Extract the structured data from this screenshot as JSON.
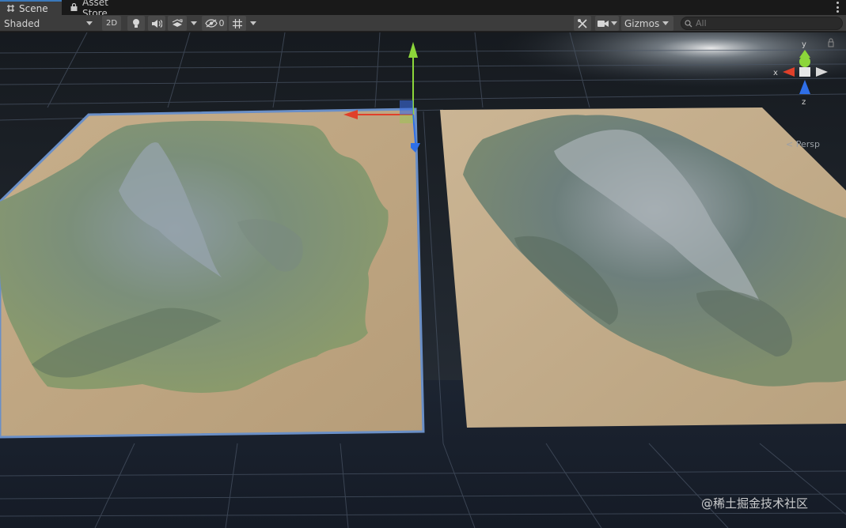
{
  "tabs": [
    {
      "label": "Scene",
      "active": true
    },
    {
      "label": "Asset Store",
      "active": false
    }
  ],
  "toolbar": {
    "shading_mode": "Shaded",
    "mode_2d_label": "2D",
    "hidden_objects_count": "0",
    "gizmos_label": "Gizmos",
    "search_placeholder": "All"
  },
  "scene": {
    "camera_projection": "< Persp",
    "orientation_gizmo": {
      "x_label": "x",
      "y_label": "y",
      "z_label": "z"
    }
  },
  "watermark": "@稀土掘金技术社区",
  "colors": {
    "accent_tab": "#3a79bb",
    "axis_x": "#e0402a",
    "axis_y": "#8cd63a",
    "axis_z": "#2f6fe8",
    "selection_outline": "#6a8fc7"
  },
  "icons": [
    "scene-icon",
    "asset-store-icon",
    "kebab-icon",
    "lightbulb-icon",
    "audio-icon",
    "effects-icon",
    "hidden-eye-icon",
    "grid-icon",
    "tools-icon",
    "camera-icon",
    "search-icon"
  ]
}
